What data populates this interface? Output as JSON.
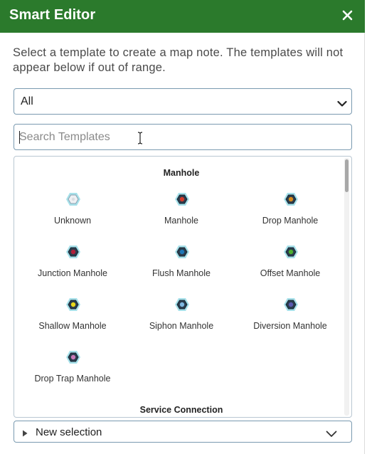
{
  "header": {
    "title": "Smart Editor",
    "close_icon": "close-icon"
  },
  "intro_text": "Select a template to create a map note. The templates will not appear below if out of range.",
  "filter": {
    "selected": "All"
  },
  "search": {
    "placeholder": "Search Templates",
    "value": ""
  },
  "groups": [
    {
      "title": "Manhole",
      "templates": [
        {
          "label": "Unknown",
          "color": "#d9dde2"
        },
        {
          "label": "Manhole",
          "color": "#d23a2a"
        },
        {
          "label": "Drop Manhole",
          "color": "#d98a1a"
        },
        {
          "label": "Junction Manhole",
          "color": "#b0203a"
        },
        {
          "label": "Flush Manhole",
          "color": "#1e78b8"
        },
        {
          "label": "Offset Manhole",
          "color": "#4caf30"
        },
        {
          "label": "Shallow Manhole",
          "color": "#e8d81a"
        },
        {
          "label": "Siphon Manhole",
          "color": "#7fb8e0"
        },
        {
          "label": "Diversion Manhole",
          "color": "#5a5ab0"
        },
        {
          "label": "Drop Trap Manhole",
          "color": "#c87ab8"
        }
      ]
    },
    {
      "title": "Service Connection",
      "templates": []
    }
  ],
  "footer": {
    "label": "New selection"
  },
  "colors": {
    "header": "#2b7a2c",
    "symbol_halo": "#5fc9d8"
  }
}
